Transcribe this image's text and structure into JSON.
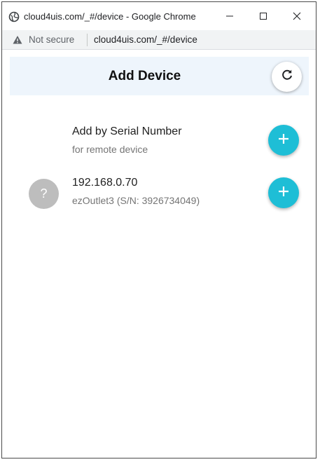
{
  "window": {
    "title": "cloud4uis.com/_#/device - Google Chrome"
  },
  "addressbar": {
    "security_label": "Not secure",
    "url": "cloud4uis.com/_#/device"
  },
  "header": {
    "title": "Add Device"
  },
  "devices": [
    {
      "primary": "Add by Serial Number",
      "secondary": "for remote device"
    },
    {
      "avatar_text": "?",
      "primary": "192.168.0.70",
      "secondary": "ezOutlet3 (S/N: 3926734049)"
    }
  ],
  "icons": {
    "title_icon": "globe-icon",
    "warning_icon": "warning-icon",
    "refresh_icon": "refresh-icon",
    "add_icon": "plus-icon"
  },
  "colors": {
    "accent": "#1ebed6",
    "header_bg": "#eef5fc",
    "avatar_bg": "#bdbdbd"
  }
}
